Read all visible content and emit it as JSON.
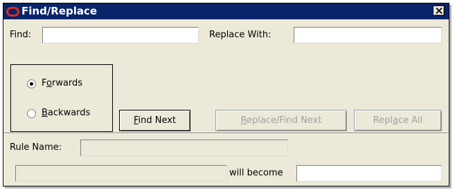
{
  "window": {
    "title": "Find/Replace",
    "icons": {
      "app": "oracle-logo-icon",
      "close": "close-icon"
    },
    "colors": {
      "titlebar": "#0a246a",
      "face": "#ece9d8",
      "logo": "#e0281a"
    }
  },
  "find": {
    "label": "Find:",
    "value": ""
  },
  "replace": {
    "label": "Replace With:",
    "value": ""
  },
  "direction": {
    "options": [
      {
        "prefix": "F",
        "mnemonic": "o",
        "rest": "rwards",
        "selected": true
      },
      {
        "prefix": "",
        "mnemonic": "B",
        "rest": "ackwards",
        "selected": false
      }
    ]
  },
  "buttons": {
    "find_next": {
      "prefix": "",
      "mnemonic": "F",
      "rest": "ind Next",
      "enabled": true
    },
    "replace_find_next": {
      "prefix": "",
      "mnemonic": "R",
      "rest": "eplace/Find Next",
      "enabled": false
    },
    "replace_all": {
      "prefix": "Repl",
      "mnemonic": "a",
      "rest": "ce All",
      "enabled": false
    }
  },
  "rule": {
    "label": "Rule Name:",
    "value": ""
  },
  "rename": {
    "from_value": "",
    "label": "will become",
    "to_value": ""
  }
}
